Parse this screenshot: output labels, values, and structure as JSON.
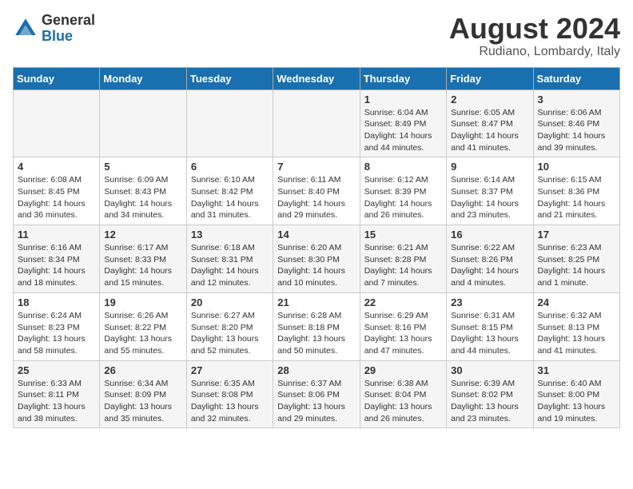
{
  "header": {
    "logo_general": "General",
    "logo_blue": "Blue",
    "month_title": "August 2024",
    "location": "Rudiano, Lombardy, Italy"
  },
  "weekdays": [
    "Sunday",
    "Monday",
    "Tuesday",
    "Wednesday",
    "Thursday",
    "Friday",
    "Saturday"
  ],
  "weeks": [
    [
      {
        "day": "",
        "info": ""
      },
      {
        "day": "",
        "info": ""
      },
      {
        "day": "",
        "info": ""
      },
      {
        "day": "",
        "info": ""
      },
      {
        "day": "1",
        "info": "Sunrise: 6:04 AM\nSunset: 8:49 PM\nDaylight: 14 hours\nand 44 minutes."
      },
      {
        "day": "2",
        "info": "Sunrise: 6:05 AM\nSunset: 8:47 PM\nDaylight: 14 hours\nand 41 minutes."
      },
      {
        "day": "3",
        "info": "Sunrise: 6:06 AM\nSunset: 8:46 PM\nDaylight: 14 hours\nand 39 minutes."
      }
    ],
    [
      {
        "day": "4",
        "info": "Sunrise: 6:08 AM\nSunset: 8:45 PM\nDaylight: 14 hours\nand 36 minutes."
      },
      {
        "day": "5",
        "info": "Sunrise: 6:09 AM\nSunset: 8:43 PM\nDaylight: 14 hours\nand 34 minutes."
      },
      {
        "day": "6",
        "info": "Sunrise: 6:10 AM\nSunset: 8:42 PM\nDaylight: 14 hours\nand 31 minutes."
      },
      {
        "day": "7",
        "info": "Sunrise: 6:11 AM\nSunset: 8:40 PM\nDaylight: 14 hours\nand 29 minutes."
      },
      {
        "day": "8",
        "info": "Sunrise: 6:12 AM\nSunset: 8:39 PM\nDaylight: 14 hours\nand 26 minutes."
      },
      {
        "day": "9",
        "info": "Sunrise: 6:14 AM\nSunset: 8:37 PM\nDaylight: 14 hours\nand 23 minutes."
      },
      {
        "day": "10",
        "info": "Sunrise: 6:15 AM\nSunset: 8:36 PM\nDaylight: 14 hours\nand 21 minutes."
      }
    ],
    [
      {
        "day": "11",
        "info": "Sunrise: 6:16 AM\nSunset: 8:34 PM\nDaylight: 14 hours\nand 18 minutes."
      },
      {
        "day": "12",
        "info": "Sunrise: 6:17 AM\nSunset: 8:33 PM\nDaylight: 14 hours\nand 15 minutes."
      },
      {
        "day": "13",
        "info": "Sunrise: 6:18 AM\nSunset: 8:31 PM\nDaylight: 14 hours\nand 12 minutes."
      },
      {
        "day": "14",
        "info": "Sunrise: 6:20 AM\nSunset: 8:30 PM\nDaylight: 14 hours\nand 10 minutes."
      },
      {
        "day": "15",
        "info": "Sunrise: 6:21 AM\nSunset: 8:28 PM\nDaylight: 14 hours\nand 7 minutes."
      },
      {
        "day": "16",
        "info": "Sunrise: 6:22 AM\nSunset: 8:26 PM\nDaylight: 14 hours\nand 4 minutes."
      },
      {
        "day": "17",
        "info": "Sunrise: 6:23 AM\nSunset: 8:25 PM\nDaylight: 14 hours\nand 1 minute."
      }
    ],
    [
      {
        "day": "18",
        "info": "Sunrise: 6:24 AM\nSunset: 8:23 PM\nDaylight: 13 hours\nand 58 minutes."
      },
      {
        "day": "19",
        "info": "Sunrise: 6:26 AM\nSunset: 8:22 PM\nDaylight: 13 hours\nand 55 minutes."
      },
      {
        "day": "20",
        "info": "Sunrise: 6:27 AM\nSunset: 8:20 PM\nDaylight: 13 hours\nand 52 minutes."
      },
      {
        "day": "21",
        "info": "Sunrise: 6:28 AM\nSunset: 8:18 PM\nDaylight: 13 hours\nand 50 minutes."
      },
      {
        "day": "22",
        "info": "Sunrise: 6:29 AM\nSunset: 8:16 PM\nDaylight: 13 hours\nand 47 minutes."
      },
      {
        "day": "23",
        "info": "Sunrise: 6:31 AM\nSunset: 8:15 PM\nDaylight: 13 hours\nand 44 minutes."
      },
      {
        "day": "24",
        "info": "Sunrise: 6:32 AM\nSunset: 8:13 PM\nDaylight: 13 hours\nand 41 minutes."
      }
    ],
    [
      {
        "day": "25",
        "info": "Sunrise: 6:33 AM\nSunset: 8:11 PM\nDaylight: 13 hours\nand 38 minutes."
      },
      {
        "day": "26",
        "info": "Sunrise: 6:34 AM\nSunset: 8:09 PM\nDaylight: 13 hours\nand 35 minutes."
      },
      {
        "day": "27",
        "info": "Sunrise: 6:35 AM\nSunset: 8:08 PM\nDaylight: 13 hours\nand 32 minutes."
      },
      {
        "day": "28",
        "info": "Sunrise: 6:37 AM\nSunset: 8:06 PM\nDaylight: 13 hours\nand 29 minutes."
      },
      {
        "day": "29",
        "info": "Sunrise: 6:38 AM\nSunset: 8:04 PM\nDaylight: 13 hours\nand 26 minutes."
      },
      {
        "day": "30",
        "info": "Sunrise: 6:39 AM\nSunset: 8:02 PM\nDaylight: 13 hours\nand 23 minutes."
      },
      {
        "day": "31",
        "info": "Sunrise: 6:40 AM\nSunset: 8:00 PM\nDaylight: 13 hours\nand 19 minutes."
      }
    ]
  ]
}
